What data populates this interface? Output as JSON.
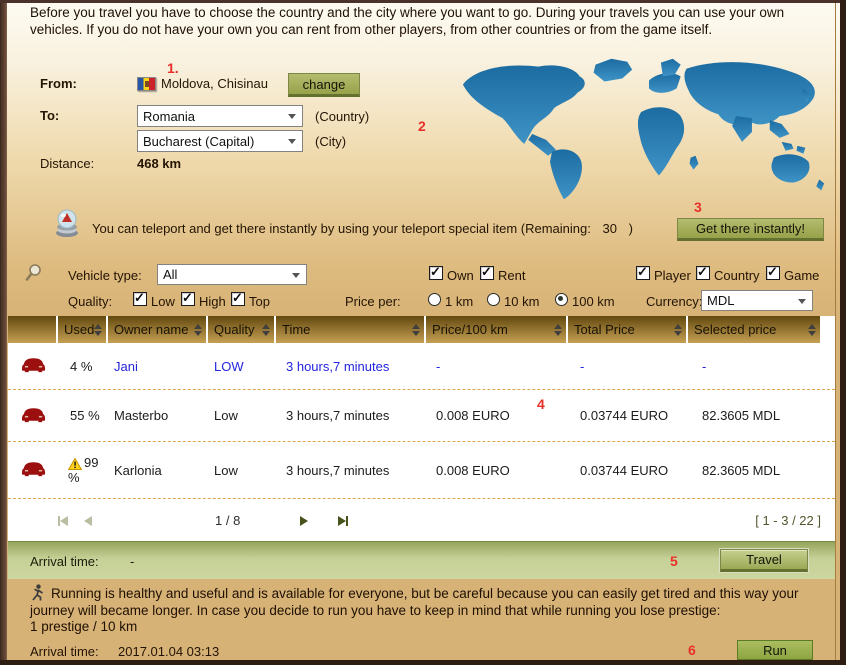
{
  "intro": {
    "text": "Before you travel you have to choose the country and the city where you want to go. During your travels you can use your own vehicles. If you do not have your own you can rent from other players, from other countries or from the game itself."
  },
  "annotations": {
    "n1": "1.",
    "n2": "2",
    "n3": "3",
    "n4": "4",
    "n5": "5",
    "n6": "6"
  },
  "form": {
    "from_label": "From:",
    "from_value": "Moldova, Chisinau",
    "change_button": "change",
    "to_label": "To:",
    "country_value": "Romania",
    "country_hint": "(Country)",
    "city_value": "Bucharest (Capital)",
    "city_hint": "(City)",
    "distance_label": "Distance:",
    "distance_value": "468 km"
  },
  "teleport": {
    "text_pre": "You can teleport and get there instantly by using your teleport special item (Remaining:",
    "remaining": "30",
    "text_close": ")",
    "button": "Get there instantly!"
  },
  "filters": {
    "vehicle_type_label": "Vehicle type:",
    "vehicle_type_value": "All",
    "own_label": "Own",
    "rent_label": "Rent",
    "player_label": "Player",
    "country_label": "Country",
    "game_label": "Game",
    "quality_label": "Quality:",
    "low_label": "Low",
    "high_label": "High",
    "top_label": "Top",
    "price_per_label": "Price per:",
    "price_options": [
      "1 km",
      "10 km",
      "100 km"
    ],
    "price_selected": "100 km",
    "currency_label": "Currency:",
    "currency_value": "MDL"
  },
  "table": {
    "headers": [
      "",
      "Used",
      "Owner name",
      "Quality",
      "Time",
      "Price/100 km",
      "Total Price",
      "Selected price"
    ],
    "rows": [
      {
        "used": "4 %",
        "owner": "Jani",
        "quality": "LOW",
        "time": "3 hours,7 minutes",
        "price": "-",
        "total": "-",
        "selected": "-"
      },
      {
        "used": "55 %",
        "owner": "Masterbo",
        "quality": "Low",
        "time": "3 hours,7 minutes",
        "price": "0.008 EURO",
        "total": "0.03744 EURO",
        "selected": "82.3605 MDL"
      },
      {
        "used": "99 %",
        "owner": "Karlonia",
        "quality": "Low",
        "time": "3 hours,7 minutes",
        "price": "0.008 EURO",
        "total": "0.03744 EURO",
        "selected": "82.3605 MDL"
      }
    ],
    "page_indicator": "1 / 8",
    "range_indicator": "[ 1 - 3 / 22 ]"
  },
  "travel_bar": {
    "arrival_label": "Arrival time:",
    "arrival_value": "-",
    "travel_button": "Travel"
  },
  "run_section": {
    "text": "Running is healthy and useful and is available for everyone, but be careful because you can easily get tired and this way your journey will became longer. In case you decide to run you have to keep in mind that while running you lose prestige:",
    "prestige_line": "1 prestige / 10 km",
    "arrival_label": "Arrival time:",
    "arrival_value": "2017.01.04 03:13",
    "run_button": "Run"
  },
  "icons": {
    "flag": "moldova-flag",
    "teleport": "crystal-ball",
    "search": "magnifier",
    "car": "red-car-front",
    "warning": "yellow-warning-triangle",
    "runner": "running-man"
  },
  "colors": {
    "header_brown_top": "#63490f",
    "header_brown_bottom": "#c6a054",
    "button_olive": "#97a24a",
    "link_blue": "#2424dd",
    "annotation_red": "#e8302a",
    "map_blue": "#2d7fb5",
    "bar_green": "#c6d198",
    "page_tan": "#d7b277"
  }
}
